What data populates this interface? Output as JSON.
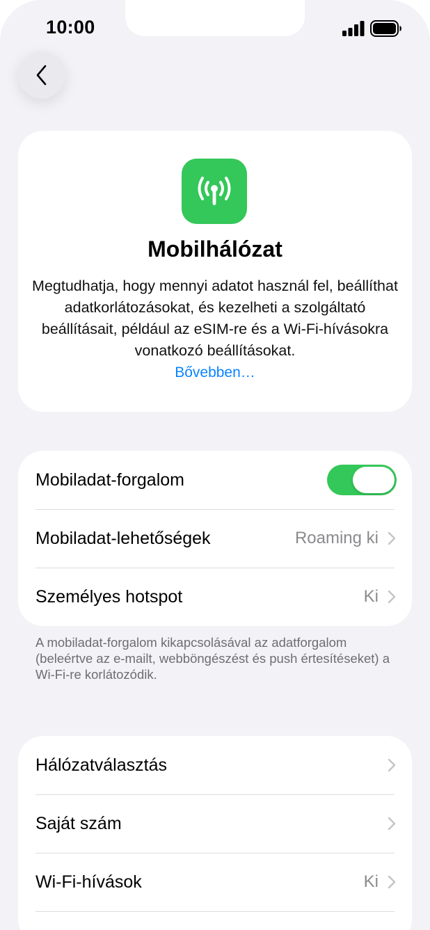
{
  "status_bar": {
    "time": "10:00"
  },
  "header": {
    "title": "Mobilhálózat",
    "description": "Megtudhatja, hogy mennyi adatot használ fel, beállíthat adatkorlátozásokat, és kezelheti a szolgáltató beállításait, például az eSIM-re és a Wi-Fi-hívásokra vonatkozó beállításokat.",
    "link": "Bővebben…"
  },
  "section1": {
    "rows": [
      {
        "label": "Mobiladat-forgalom",
        "toggle_on": true
      },
      {
        "label": "Mobiladat-lehetőségek",
        "value": "Roaming ki"
      },
      {
        "label": "Személyes hotspot",
        "value": "Ki"
      }
    ],
    "footnote": "A mobiladat-forgalom kikapcsolásával az adatforgalom (beleértve az e-mailt, webböngészést és push értesítéseket) a Wi-Fi-re korlátozódik."
  },
  "section2": {
    "rows": [
      {
        "label": "Hálózatválasztás",
        "value": ""
      },
      {
        "label": "Saját szám",
        "value": ""
      },
      {
        "label": "Wi-Fi-hívások",
        "value": "Ki"
      }
    ]
  },
  "colors": {
    "accent": "#0a84ff",
    "toggle_on": "#34c759",
    "background": "#f2f2f7"
  }
}
